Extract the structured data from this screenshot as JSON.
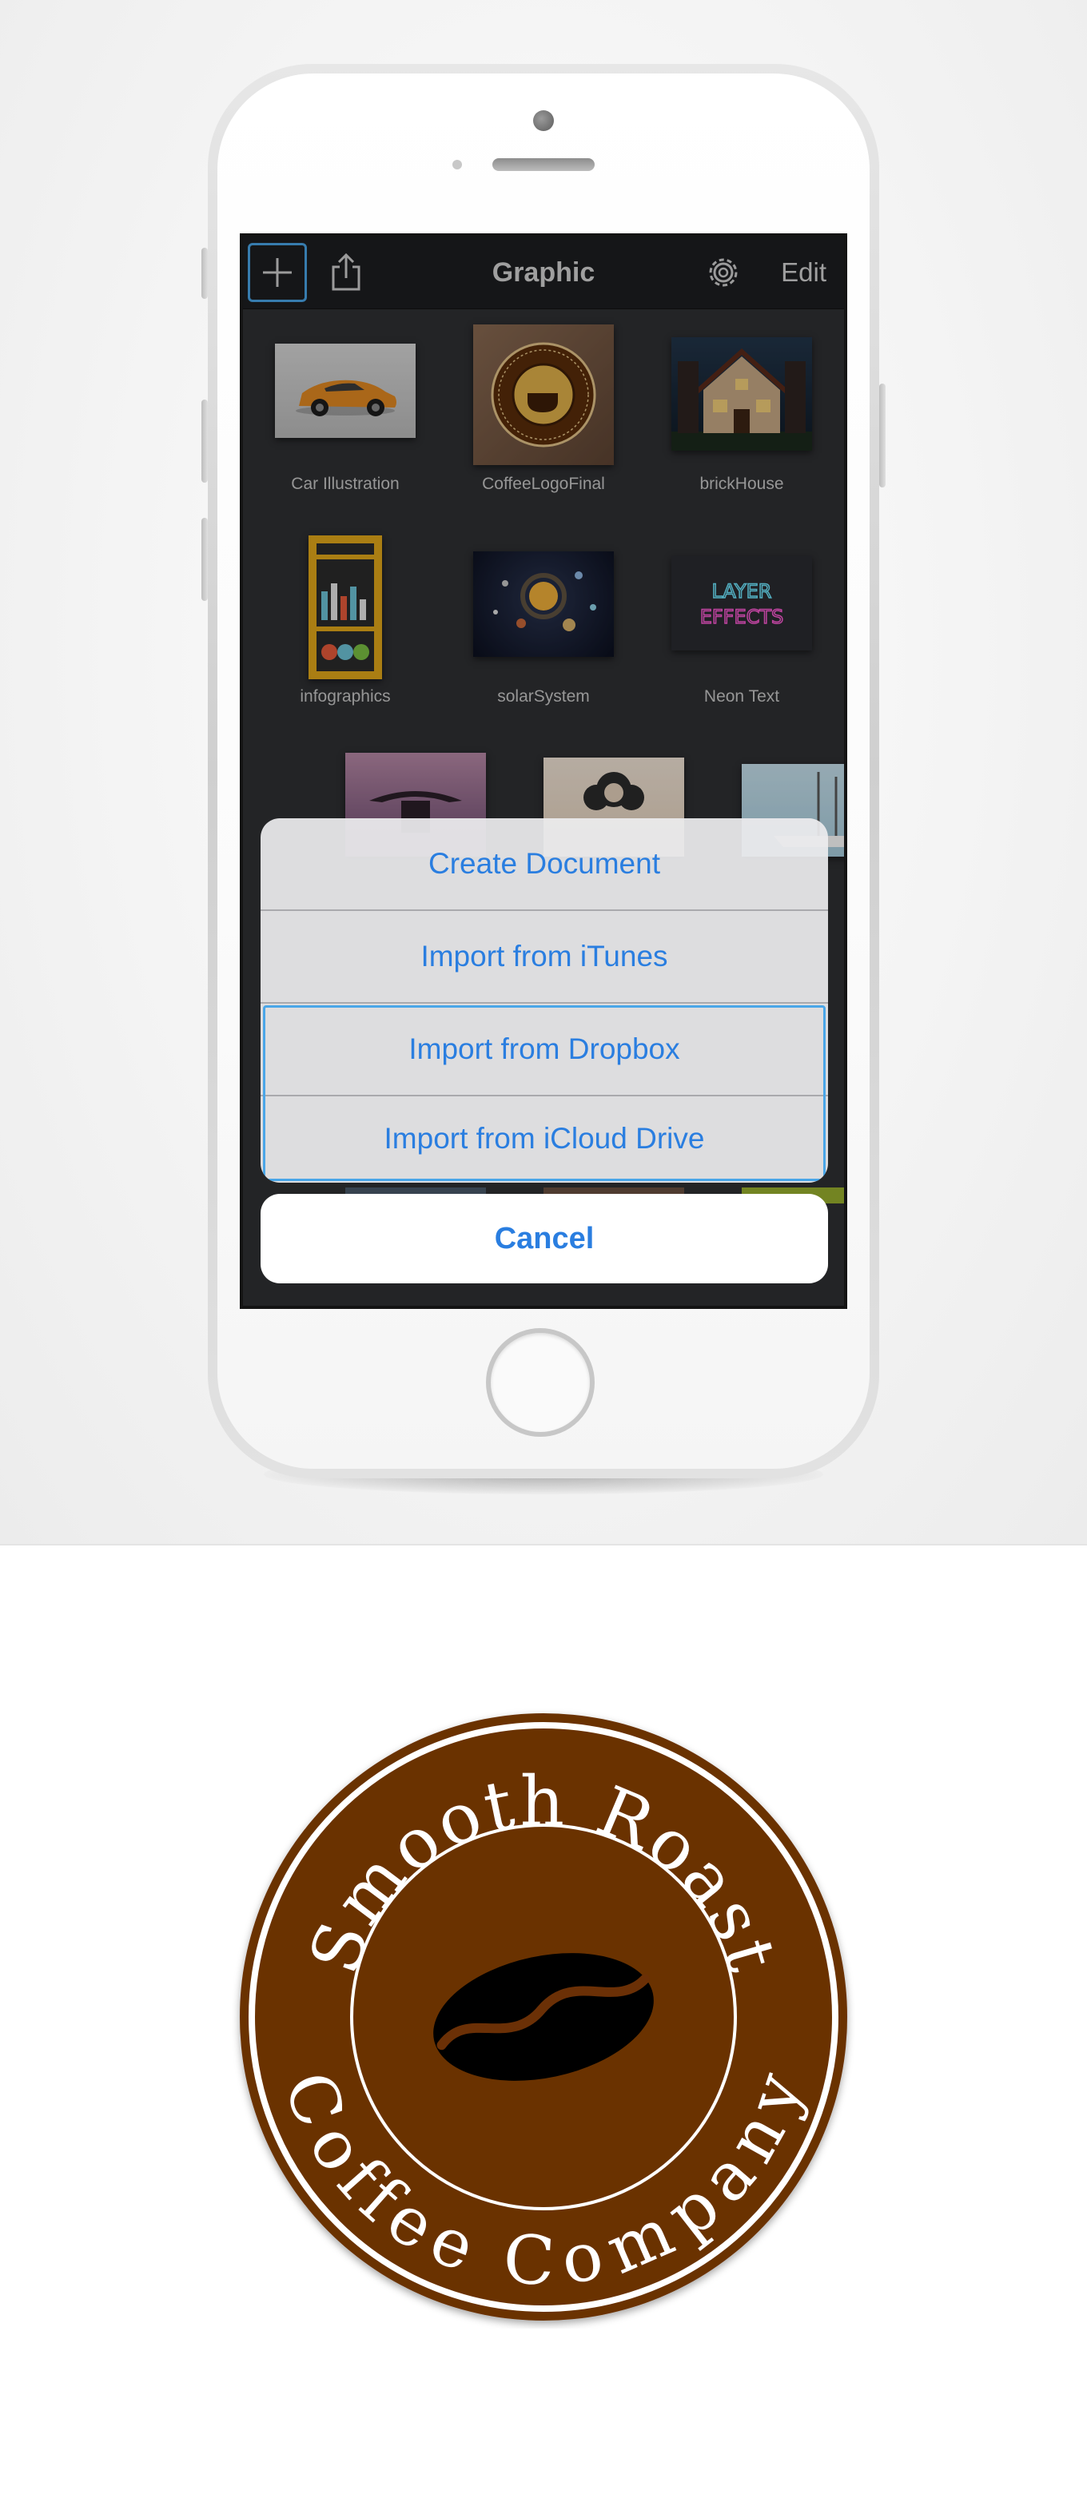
{
  "navbar": {
    "title": "Graphic",
    "edit_label": "Edit",
    "add_icon": "plus-icon",
    "share_icon": "share-icon",
    "settings_icon": "gear-icon"
  },
  "documents": [
    {
      "name": "Car Illustration"
    },
    {
      "name": "CoffeeLogoFinal"
    },
    {
      "name": "brickHouse"
    },
    {
      "name": "infographics"
    },
    {
      "name": "solarSystem"
    },
    {
      "name": "Neon Text"
    }
  ],
  "neon_text_thumb": {
    "line1": "LAYER",
    "line2": "EFFECTS"
  },
  "action_sheet": {
    "items": [
      "Create Document",
      "Import from iTunes",
      "Import from Dropbox",
      "Import from iCloud Drive"
    ],
    "cancel_label": "Cancel"
  },
  "logo": {
    "top_text": "Smooth Roast",
    "bottom_text": "Coffee Company",
    "colors": {
      "badge": "#6b3006",
      "ring": "#ffffff",
      "bean": "#000000"
    }
  },
  "colors": {
    "accent": "#2a7ee0",
    "highlight": "#4aa6e8",
    "screen_bg": "#2f3033"
  }
}
